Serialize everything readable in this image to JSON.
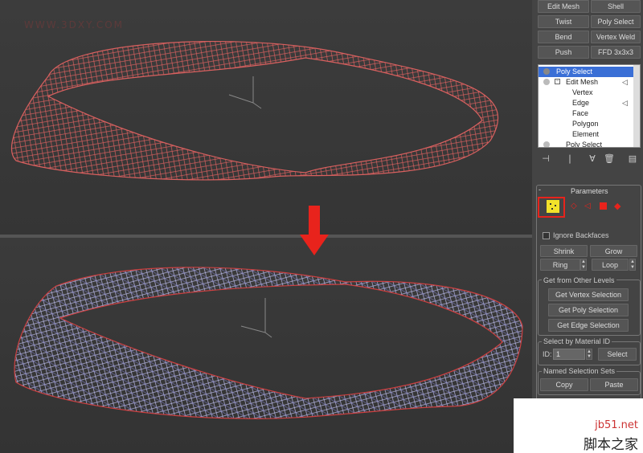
{
  "watermark": "WWW.3DXY.COM",
  "modifier_buttons": {
    "edit_mesh": "Edit Mesh",
    "shell": "Shell",
    "twist": "Twist",
    "poly_select": "Poly Select",
    "bend": "Bend",
    "vertex_weld": "Vertex Weld",
    "push": "Push",
    "ffd": "FFD 3x3x3"
  },
  "stack": {
    "items": [
      "Poly Select",
      "Edit Mesh",
      "Vertex",
      "Edge",
      "Face",
      "Polygon",
      "Element",
      "Poly Select"
    ]
  },
  "parameters": {
    "title": "Parameters",
    "ignore_backfaces": "Ignore Backfaces",
    "shrink": "Shrink",
    "grow": "Grow",
    "ring": "Ring",
    "loop": "Loop"
  },
  "other_levels": {
    "title": "Get from Other Levels",
    "vertex": "Get Vertex Selection",
    "poly": "Get Poly Selection",
    "edge": "Get Edge Selection"
  },
  "material": {
    "title": "Select by Material ID",
    "id_label": "ID:",
    "id_value": "1",
    "select": "Select"
  },
  "named_sets": {
    "title": "Named Selection Sets",
    "copy": "Copy",
    "paste": "Paste"
  },
  "badge": {
    "site": "jb51.net",
    "name": "脚本之家"
  },
  "colors": {
    "mesh_top": "#d9605f",
    "mesh_bottom": "#b9b9e6",
    "arrow": "#e8231c",
    "highlight": "#e8231c",
    "yellow": "#f2e22a"
  }
}
